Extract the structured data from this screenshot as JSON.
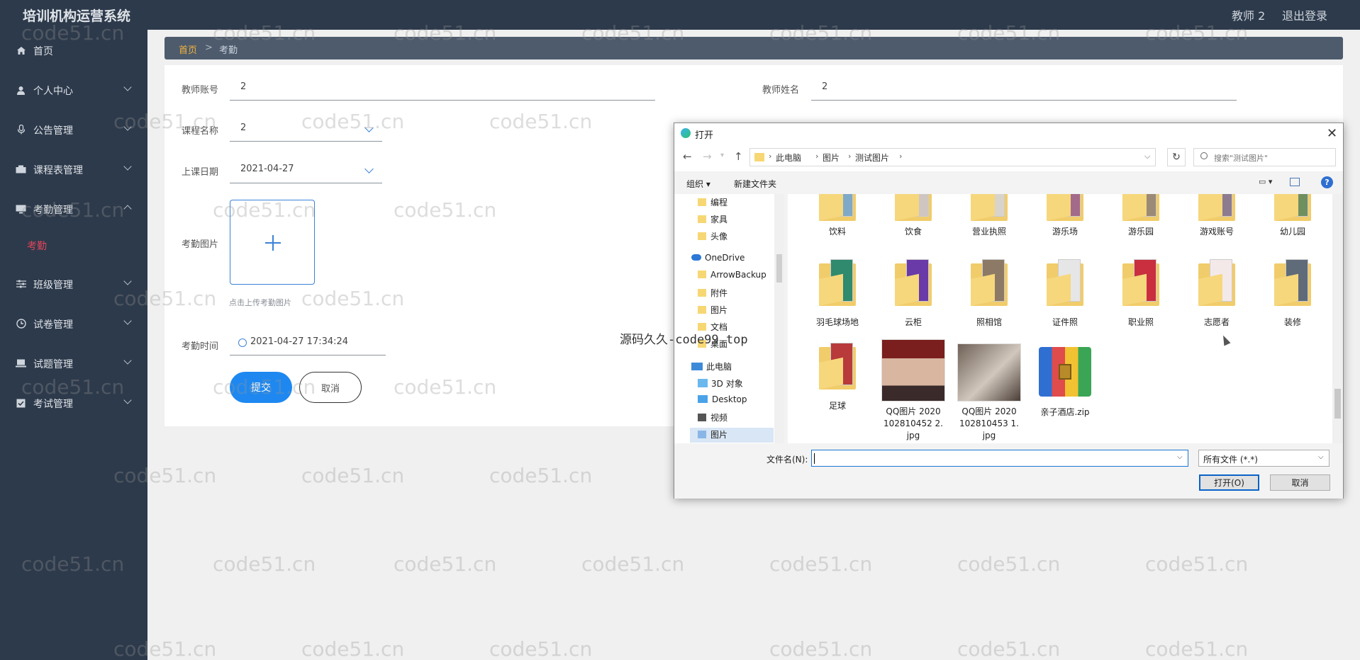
{
  "header": {
    "title": "培训机构运营系统",
    "user": "教师 2",
    "logout": "退出登录"
  },
  "sidebar": {
    "items": [
      {
        "label": "首页",
        "icon": "home-icon"
      },
      {
        "label": "个人中心",
        "icon": "user-icon"
      },
      {
        "label": "公告管理",
        "icon": "mic-icon"
      },
      {
        "label": "课程表管理",
        "icon": "schedule-icon"
      },
      {
        "label": "考勤管理",
        "icon": "monitor-icon"
      },
      {
        "label": "班级管理",
        "icon": "sliders-icon"
      },
      {
        "label": "试卷管理",
        "icon": "clock-icon"
      },
      {
        "label": "试题管理",
        "icon": "laptop-icon"
      },
      {
        "label": "考试管理",
        "icon": "check-icon"
      }
    ],
    "active_sub": "考勤"
  },
  "breadcrumb": {
    "home": "首页",
    "sep": ">",
    "current": "考勤"
  },
  "form": {
    "teacher_account_label": "教师账号",
    "teacher_account_value": "2",
    "teacher_name_label": "教师姓名",
    "teacher_name_value": "2",
    "course_label": "课程名称",
    "course_value": "2",
    "date_label": "上课日期",
    "date_value": "2021-04-27",
    "photo_label": "考勤图片",
    "upload_hint": "点击上传考勤图片",
    "time_label": "考勤时间",
    "time_value": "2021-04-27 17:34:24",
    "submit": "提交",
    "cancel": "取消"
  },
  "watermark": "code51.cn",
  "overlay_text": "源码久久-code99 top",
  "dialog": {
    "title": "打开",
    "close": "✕",
    "path": [
      "此电脑",
      "图片",
      "测试图片"
    ],
    "search_placeholder": "搜索\"测试图片\"",
    "organize": "组织 ▾",
    "new_folder": "新建文件夹",
    "help": "?",
    "tree": [
      {
        "label": "编程",
        "type": "folder"
      },
      {
        "label": "家具",
        "type": "folder"
      },
      {
        "label": "头像",
        "type": "folder"
      },
      {
        "label": "OneDrive",
        "type": "cloud"
      },
      {
        "label": "ArrowBackup",
        "type": "folder"
      },
      {
        "label": "附件",
        "type": "folder"
      },
      {
        "label": "图片",
        "type": "folder"
      },
      {
        "label": "文档",
        "type": "folder"
      },
      {
        "label": "桌面",
        "type": "folder"
      },
      {
        "label": "此电脑",
        "type": "pc"
      },
      {
        "label": "3D 对象",
        "type": "object"
      },
      {
        "label": "Desktop",
        "type": "desktop"
      },
      {
        "label": "视频",
        "type": "video"
      },
      {
        "label": "图片",
        "type": "pictures"
      }
    ],
    "files_row1": [
      "饮料",
      "饮食",
      "营业执照",
      "游乐场",
      "游乐园",
      "游戏账号",
      "幼儿园"
    ],
    "files_row2": [
      "羽毛球场地",
      "云柜",
      "照相馆",
      "证件照",
      "职业照",
      "志愿者",
      "装修"
    ],
    "files_row3": [
      {
        "name": "足球",
        "kind": "folder"
      },
      {
        "name": "QQ图片 2020102810452 2.jpg",
        "kind": "image"
      },
      {
        "name": "QQ图片 2020102810453 1.jpg",
        "kind": "image"
      },
      {
        "name": "亲子酒店.zip",
        "kind": "zip"
      }
    ],
    "filename_label": "文件名(N):",
    "filename_value": "",
    "filetype": "所有文件 (*.*)",
    "open": "打开(O)",
    "cancel": "取消"
  },
  "colors": {
    "sidebar_bg": "#2d3a4b",
    "accent": "#1e88f0",
    "active_sub": "#e0455a",
    "breadcrumb_home": "#f2b33d"
  }
}
